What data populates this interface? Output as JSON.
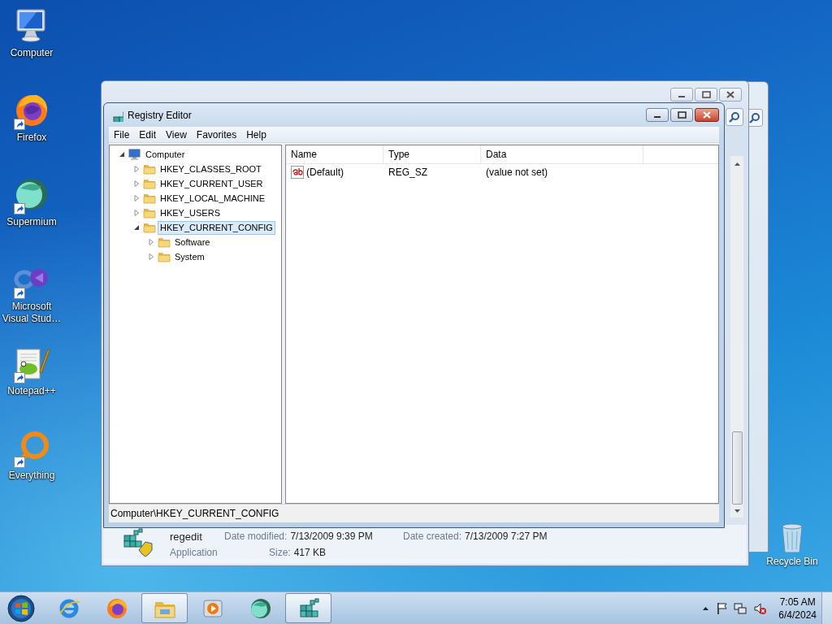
{
  "desktop_icons": [
    {
      "kind": "computer",
      "label": "Computer",
      "shortcut": false
    },
    {
      "kind": "firefox",
      "label": "Firefox",
      "shortcut": true
    },
    {
      "kind": "supermium",
      "label": "Supermium",
      "shortcut": true
    },
    {
      "kind": "studio",
      "label": "Microsoft Visual Stud…",
      "shortcut": true
    },
    {
      "kind": "notepad",
      "label": "Notepad++",
      "shortcut": true
    },
    {
      "kind": "everything",
      "label": "Everything",
      "shortcut": true
    }
  ],
  "recycle_bin": {
    "label": "Recycle Bin"
  },
  "background_window": {
    "file_name": "regedit",
    "file_type": "Application",
    "date_modified_label": "Date modified:",
    "date_modified": "7/13/2009 9:39 PM",
    "date_created_label": "Date created:",
    "date_created": "7/13/2009 7:27 PM",
    "size_label": "Size:",
    "size": "417 KB"
  },
  "registry_editor": {
    "title": "Registry Editor",
    "menu": [
      "File",
      "Edit",
      "View",
      "Favorites",
      "Help"
    ],
    "tree": [
      {
        "label": "Computer",
        "kind": "computer",
        "expanded": true,
        "selected": false,
        "children": [
          {
            "label": "HKEY_CLASSES_ROOT",
            "kind": "folder",
            "expanded": false,
            "selected": false
          },
          {
            "label": "HKEY_CURRENT_USER",
            "kind": "folder",
            "expanded": false,
            "selected": false
          },
          {
            "label": "HKEY_LOCAL_MACHINE",
            "kind": "folder",
            "expanded": false,
            "selected": false
          },
          {
            "label": "HKEY_USERS",
            "kind": "folder",
            "expanded": false,
            "selected": false
          },
          {
            "label": "HKEY_CURRENT_CONFIG",
            "kind": "folder",
            "expanded": true,
            "selected": true,
            "children": [
              {
                "label": "Software",
                "kind": "folder",
                "expanded": false,
                "selected": false
              },
              {
                "label": "System",
                "kind": "folder",
                "expanded": false,
                "selected": false
              }
            ]
          }
        ]
      }
    ],
    "columns": [
      "Name",
      "Type",
      "Data"
    ],
    "rows": [
      {
        "name": "(Default)",
        "type": "REG_SZ",
        "data": "(value not set)"
      }
    ],
    "status_bar": "Computer\\HKEY_CURRENT_CONFIG"
  },
  "taskbar": {
    "apps": [
      {
        "kind": "ie",
        "open": false
      },
      {
        "kind": "firefox",
        "open": false
      },
      {
        "kind": "explorer",
        "open": true
      },
      {
        "kind": "media",
        "open": false
      },
      {
        "kind": "supermium",
        "open": false
      },
      {
        "kind": "regedit",
        "open": true
      }
    ],
    "clock": {
      "time": "7:05 AM",
      "date": "6/4/2024"
    }
  }
}
